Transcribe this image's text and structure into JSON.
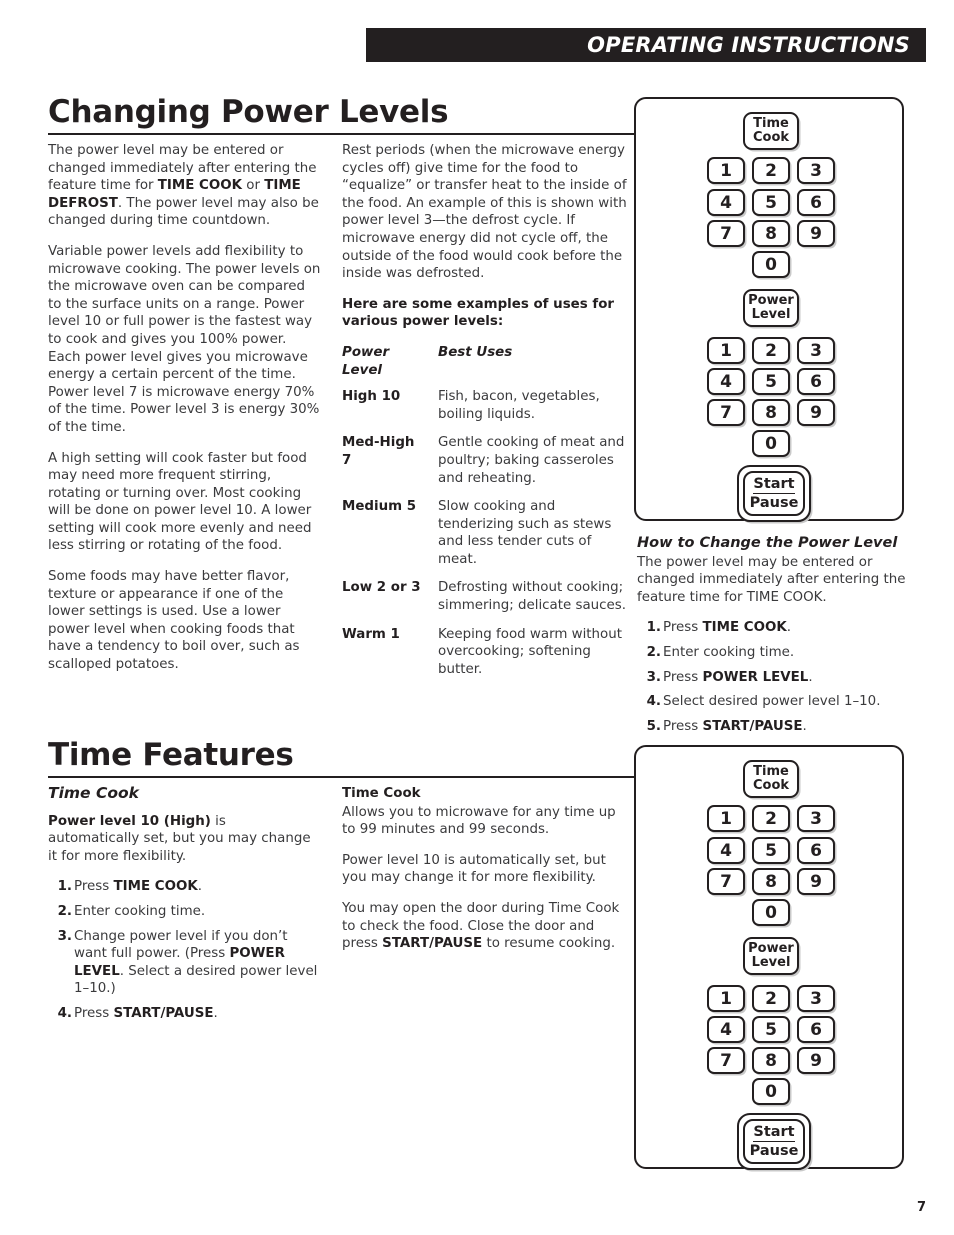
{
  "header": {
    "title": "OPERATING INSTRUCTIONS"
  },
  "page_number": "7",
  "section1": {
    "title": "Changing Power Levels",
    "left_col": {
      "p1_a": "The power level may be entered or changed immediately after entering the feature time for ",
      "p1_b": "TIME COOK",
      "p1_c": " or ",
      "p1_d": "TIME DEFROST",
      "p1_e": ". The power level may also be changed during time countdown.",
      "p2": "Variable power levels add flexibility to microwave cooking. The power levels on the microwave oven can be compared to the surface units on a range. Power level 10 or full power is the fastest way to cook and gives you 100% power. Each power level gives you microwave energy a certain percent of the time. Power level 7 is microwave energy 70% of the time. Power level 3 is energy 30% of the time.",
      "p3": "A high setting will cook faster but food may need more frequent stirring, rotating or turning over. Most cooking will be done on power level 10. A lower setting will cook more evenly and need less stirring or rotating of the food.",
      "p4": "Some foods may have better flavor, texture or appearance if one of the lower settings is used. Use a lower power level when cooking foods that have a tendency to boil over, such as scalloped potatoes."
    },
    "mid_col": {
      "p1": "Rest periods (when the microwave energy cycles off) give time for the food to “equalize” or transfer heat to the inside of the food. An example of this is shown with power level 3—the defrost cycle. If microwave energy did not cycle off, the outside of the food would cook before the inside was defrosted.",
      "p2": "Here are some examples of uses for various power levels:",
      "table": {
        "col1_header": "Power Level",
        "col2_header": "Best Uses",
        "rows": [
          {
            "level": "High 10",
            "uses": "Fish, bacon, vegetables, boiling liquids."
          },
          {
            "level": "Med-High 7",
            "uses": "Gentle cooking of meat and poultry; baking casseroles and reheating."
          },
          {
            "level": "Medium 5",
            "uses": "Slow cooking and tenderizing such as stews and less tender cuts of meat."
          },
          {
            "level": "Low 2 or 3",
            "uses": "Defrosting without cooking; simmering; delicate sauces."
          },
          {
            "level": "Warm 1",
            "uses": "Keeping food warm without overcooking; softening butter."
          }
        ]
      }
    },
    "right_col": {
      "heading": "How to Change the Power Level",
      "intro": "The power level may be entered or changed immediately after entering the feature time for TIME COOK.",
      "steps": [
        {
          "pre": "Press ",
          "bold": "TIME COOK",
          "post": "."
        },
        {
          "pre": "Enter cooking time.",
          "bold": "",
          "post": ""
        },
        {
          "pre": "Press ",
          "bold": "POWER LEVEL",
          "post": "."
        },
        {
          "pre": "Select desired power level 1–10.",
          "bold": "",
          "post": ""
        },
        {
          "pre": "Press ",
          "bold": "START/PAUSE",
          "post": "."
        }
      ]
    }
  },
  "section2": {
    "title": "Time Features",
    "left_col": {
      "subhead": "Time Cook",
      "p1_bold": "Power level 10 (High)",
      "p1_rest": " is automatically set, but you may change it for more flexibility.",
      "steps": [
        {
          "pre": "Press ",
          "bold": "TIME COOK",
          "post": "."
        },
        {
          "pre": "Enter cooking time.",
          "bold": "",
          "post": ""
        },
        {
          "pre": "Change power level if you don’t want full power. (Press ",
          "bold": "POWER LEVEL",
          "post": ". Select a desired power level 1–10.)"
        },
        {
          "pre": "Press ",
          "bold": "START/PAUSE",
          "post": "."
        }
      ]
    },
    "mid_col": {
      "subhead": "Time Cook",
      "p1": "Allows you to microwave for any time up to 99 minutes and 99 seconds.",
      "p2": "Power level 10 is automatically set, but you may change it for more flexibility.",
      "p3_a": "You may open the door during Time Cook to check the food. Close the door and press ",
      "p3_b": "START/PAUSE",
      "p3_c": " to resume cooking."
    }
  },
  "keypad": {
    "time_cook_line1": "Time",
    "time_cook_line2": "Cook",
    "power_level_line1": "Power",
    "power_level_line2": "Level",
    "start_line1": "Start",
    "start_line2": "Pause",
    "digits_rows": [
      [
        "1",
        "2",
        "3"
      ],
      [
        "4",
        "5",
        "6"
      ],
      [
        "7",
        "8",
        "9"
      ]
    ],
    "zero": "0"
  }
}
